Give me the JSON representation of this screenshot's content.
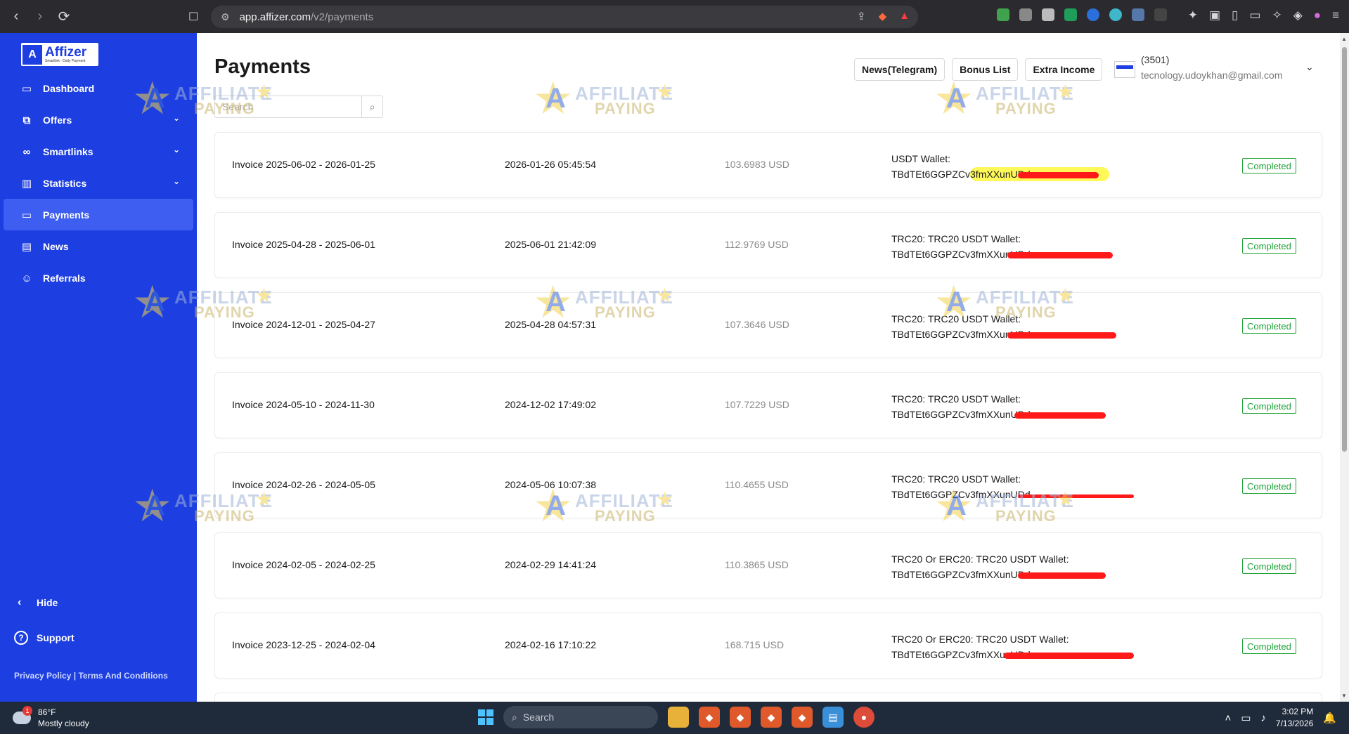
{
  "browser": {
    "url_domain": "app.affizer.com",
    "url_path": "/v2/payments",
    "nav_back_icon": "chevron-left",
    "nav_forward_icon": "chevron-right",
    "reload_icon": "reload"
  },
  "brand": {
    "logo_text": "Affizer",
    "logo_tagline": "Smartlink - Daily Payment",
    "sidebar_color": "#1d3ee0"
  },
  "sidebar": {
    "items": [
      {
        "label": "Dashboard",
        "icon": "dashboard-icon"
      },
      {
        "label": "Offers",
        "icon": "offers-icon",
        "has_chevron": true
      },
      {
        "label": "Smartlinks",
        "icon": "link-icon",
        "has_chevron": true
      },
      {
        "label": "Statistics",
        "icon": "bar-chart-icon",
        "has_chevron": true
      },
      {
        "label": "Payments",
        "icon": "wallet-icon",
        "active": true
      },
      {
        "label": "News",
        "icon": "news-icon"
      },
      {
        "label": "Referrals",
        "icon": "users-icon"
      }
    ],
    "hide_label": "Hide",
    "support_label": "Support",
    "privacy_label": "Privacy Policy",
    "separator": "|",
    "terms_label": "Terms And Conditions"
  },
  "header": {
    "title": "Payments",
    "buttons": [
      "News(Telegram)",
      "Bonus List",
      "Extra Income"
    ],
    "user_id": "(3501)",
    "user_email": "tecnology.udoykhan@gmail.com"
  },
  "search": {
    "placeholder": "Search"
  },
  "payments": [
    {
      "invoice": "Invoice 2025-06-02 - 2026-01-25",
      "date": "2026-01-26 05:45:54",
      "amount": "103.6983 USD",
      "wallet_type": "USDT Wallet:",
      "wallet_addr": "TBdTEt6GGPZCv3fmXXunUDd",
      "status": "Completed"
    },
    {
      "invoice": "Invoice 2025-04-28 - 2025-06-01",
      "date": "2025-06-01 21:42:09",
      "amount": "112.9769 USD",
      "wallet_type": "TRC20: TRC20 USDT Wallet:",
      "wallet_addr": "TBdTEt6GGPZCv3fmXXunUDd",
      "status": "Completed"
    },
    {
      "invoice": "Invoice 2024-12-01 - 2025-04-27",
      "date": "2025-04-28 04:57:31",
      "amount": "107.3646 USD",
      "wallet_type": "TRC20: TRC20 USDT Wallet:",
      "wallet_addr": "TBdTEt6GGPZCv3fmXXunUDd",
      "status": "Completed"
    },
    {
      "invoice": "Invoice 2024-05-10 - 2024-11-30",
      "date": "2024-12-02 17:49:02",
      "amount": "107.7229 USD",
      "wallet_type": "TRC20: TRC20 USDT Wallet:",
      "wallet_addr": "TBdTEt6GGPZCv3fmXXunUDd",
      "status": "Completed"
    },
    {
      "invoice": "Invoice 2024-02-26 - 2024-05-05",
      "date": "2024-05-06 10:07:38",
      "amount": "110.4655 USD",
      "wallet_type": "TRC20: TRC20 USDT Wallet:",
      "wallet_addr": "TBdTEt6GGPZCv3fmXXunUDd",
      "status": "Completed"
    },
    {
      "invoice": "Invoice 2024-02-05 - 2024-02-25",
      "date": "2024-02-29 14:41:24",
      "amount": "110.3865 USD",
      "wallet_type": "TRC20 Or ERC20: TRC20 USDT Wallet:",
      "wallet_addr": "TBdTEt6GGPZCv3fmXXunUDd",
      "status": "Completed"
    },
    {
      "invoice": "Invoice 2023-12-25 - 2024-02-04",
      "date": "2024-02-16 17:10:22",
      "amount": "168.715 USD",
      "wallet_type": "TRC20 Or ERC20: TRC20 USDT Wallet:",
      "wallet_addr": "TBdTEt6GGPZCv3fmXXunUDd",
      "status": "Completed"
    }
  ],
  "status_color": "#22a33a",
  "watermark": {
    "line1": "AFFILIATE",
    "line2": "PAYING"
  },
  "taskbar": {
    "weather_temp": "86°F",
    "weather_desc": "Mostly cloudy",
    "search_label": "Search",
    "time": "3:02 PM",
    "date": "7/13/2026"
  }
}
